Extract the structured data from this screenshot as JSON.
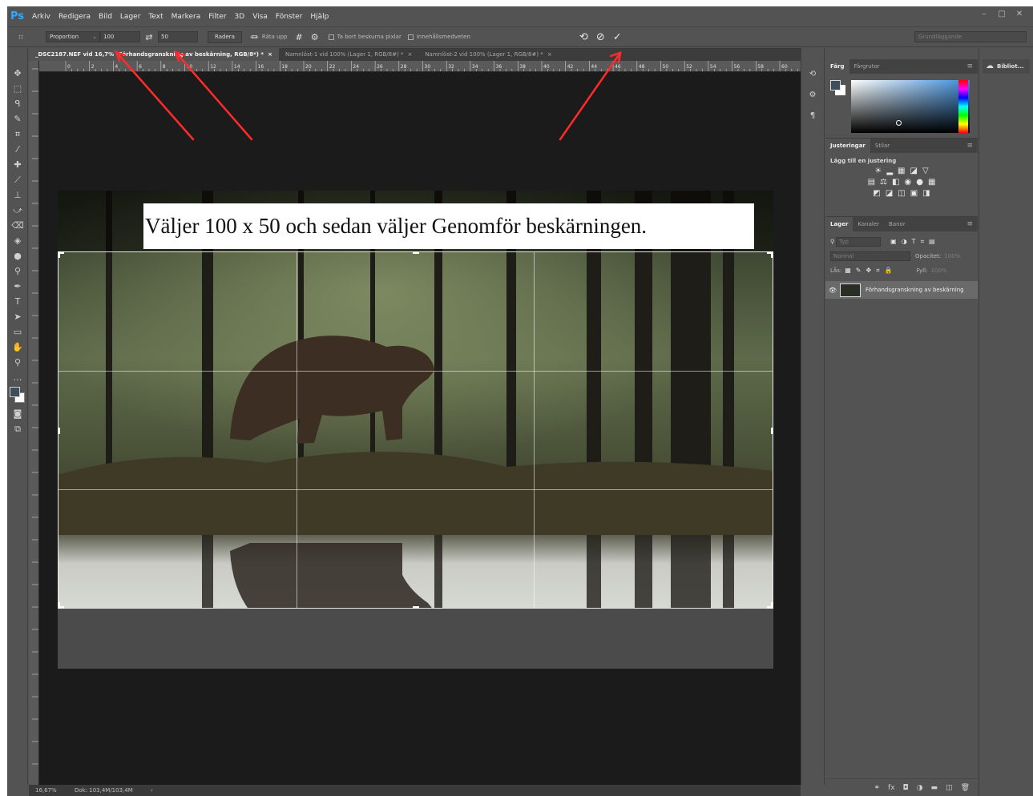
{
  "menu": {
    "logo": "Ps",
    "items": [
      "Arkiv",
      "Redigera",
      "Bild",
      "Lager",
      "Text",
      "Markera",
      "Filter",
      "3D",
      "Visa",
      "Fönster",
      "Hjälp"
    ]
  },
  "window_controls": {
    "minimize": "–",
    "maximize": "□",
    "close": "✕"
  },
  "options": {
    "tool_icon": "crop-tool-icon",
    "ratio_select": "Proportion",
    "width_value": "100",
    "swap_icon": "⇄",
    "height_value": "50",
    "clear_button": "Radera",
    "straighten_label": "Räta upp",
    "delete_cropped_label": "Ta bort beskurna pixlar",
    "content_aware_label": "Innehållsmedveten",
    "reset_icon": "⟲",
    "cancel_icon": "⊘",
    "commit_icon": "✓",
    "workspace": "Grundläggande"
  },
  "tabs": [
    {
      "label": "_DSC2187.NEF vid 16,7% (Förhandsgranskning av beskärning, RGB/8*) *",
      "close": "×"
    },
    {
      "label": "Namnlöst-1 vid 100% (Lager 1, RGB/8#) *",
      "close": "×"
    },
    {
      "label": "Namnlöst-2 vid 100% (Lager 1, RGB/8#) *",
      "close": "×"
    }
  ],
  "ruler_labels": [
    "0",
    "2",
    "4",
    "6",
    "8",
    "10",
    "12",
    "14",
    "16",
    "18",
    "20",
    "22",
    "24",
    "26",
    "28",
    "30",
    "32",
    "34",
    "36",
    "38",
    "40",
    "42",
    "44",
    "46",
    "48",
    "50",
    "52",
    "54",
    "56",
    "58",
    "60",
    "62"
  ],
  "annotation": "Väljer 100 x 50 och sedan väljer Genomför beskärningen.",
  "status": {
    "zoom": "16,67%",
    "doc": "Dok: 103,4M/103,4M",
    "arrow": "›"
  },
  "panels": {
    "color_tabs": [
      "Färg",
      "Färgrutor"
    ],
    "adjust_tabs": [
      "Justeringar",
      "Stilar"
    ],
    "adjust_title": "Lägg till en justering",
    "layers_tabs": [
      "Lager",
      "Kanaler",
      "Banor"
    ],
    "filter_placeholder": "Typ",
    "blend_mode": "Normal",
    "opacity_label": "Opacitet:",
    "opacity_value": "100%",
    "lock_label": "Lås:",
    "fill_label": "Fyll:",
    "fill_value": "100%",
    "layer_name": "Förhandsgranskning av beskärning",
    "library_button": "Bibliot..."
  },
  "colors": {
    "foreground": "#3e4f5b",
    "background": "#ffffff",
    "accent": "#31a8ff",
    "annotation_arrow": "#ff2a2a"
  }
}
